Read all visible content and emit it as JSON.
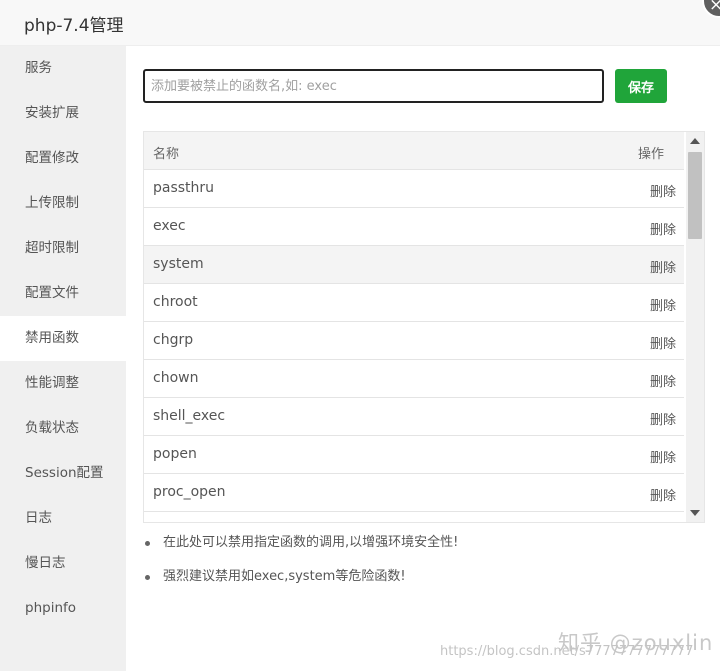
{
  "window": {
    "title": "php-7.4管理"
  },
  "sidebar": {
    "items": [
      {
        "label": "服务"
      },
      {
        "label": "安装扩展"
      },
      {
        "label": "配置修改"
      },
      {
        "label": "上传限制"
      },
      {
        "label": "超时限制"
      },
      {
        "label": "配置文件"
      },
      {
        "label": "禁用函数",
        "active": true
      },
      {
        "label": "性能调整"
      },
      {
        "label": "负载状态"
      },
      {
        "label": "Session配置"
      },
      {
        "label": "日志"
      },
      {
        "label": "慢日志"
      },
      {
        "label": "phpinfo"
      }
    ]
  },
  "form": {
    "placeholder": "添加要被禁止的函数名,如: exec",
    "save_label": "保存"
  },
  "table": {
    "header_name": "名称",
    "header_op": "操作",
    "delete_label": "删除",
    "rows": [
      {
        "name": "passthru"
      },
      {
        "name": "exec"
      },
      {
        "name": "system"
      },
      {
        "name": "chroot"
      },
      {
        "name": "chgrp"
      },
      {
        "name": "chown"
      },
      {
        "name": "shell_exec"
      },
      {
        "name": "popen"
      },
      {
        "name": "proc_open"
      }
    ]
  },
  "notes": [
    "在此处可以禁用指定函数的调用,以增强环境安全性!",
    "强烈建议禁用如exec,system等危险函数!"
  ],
  "watermark": {
    "text": "知乎 @zouxlin",
    "url": "https://blog.csdn.net/s7777777777777"
  }
}
